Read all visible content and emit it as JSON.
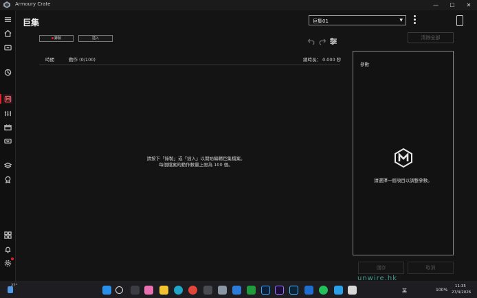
{
  "app": {
    "title": "Armoury Crate",
    "page_title": "巨集"
  },
  "profile": {
    "selected": "巨集01"
  },
  "toolbar": {
    "record_label": "錄製",
    "insert_label": "插入",
    "clear_all_label": "清除全部"
  },
  "table": {
    "col_time": "時間",
    "col_action": "動作 (0/100)",
    "total_length": "總時長： 0.000 秒"
  },
  "empty_state": {
    "line1": "請按下「錄製」或「插入」以開始編輯巨集檔案。",
    "line2": "每個檔案的動作數量上限為 100 個。"
  },
  "params_panel": {
    "title": "參數",
    "message": "請選擇一個項目以調整參數。"
  },
  "footer": {
    "save_label": "儲存",
    "cancel_label": "取消"
  },
  "taskbar": {
    "weather": "27°",
    "ime": "英",
    "battery": "100%",
    "time": "11:35",
    "date": "27/4/2026"
  },
  "watermark": "unwire.hk",
  "colors": {
    "accent": "#e0212e",
    "background": "#141414",
    "panel_border": "#8a8a8a"
  }
}
